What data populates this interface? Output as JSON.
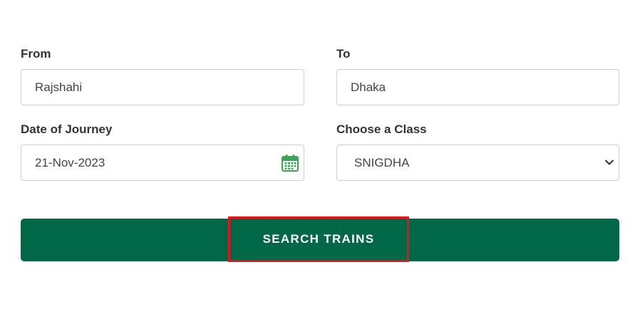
{
  "from": {
    "label": "From",
    "value": "Rajshahi"
  },
  "to": {
    "label": "To",
    "value": "Dhaka"
  },
  "date": {
    "label": "Date of Journey",
    "value": "21-Nov-2023"
  },
  "class": {
    "label": "Choose a Class",
    "selected": "SNIGDHA"
  },
  "search": {
    "label": "SEARCH TRAINS"
  },
  "colors": {
    "primary": "#006747",
    "highlight": "#e8131a",
    "calendar_icon": "#3aa655"
  },
  "icons": {
    "date": "calendar-icon",
    "class": "chevron-down-icon"
  }
}
